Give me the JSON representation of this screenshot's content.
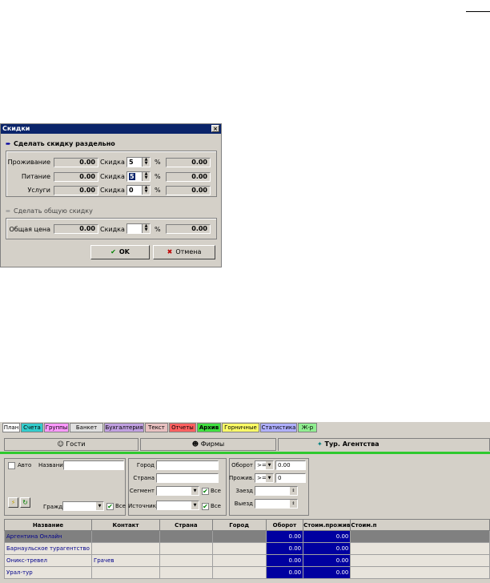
{
  "dialog": {
    "title": "Скидки",
    "close_glyph": "×",
    "section_separate": "Сделать скидку раздельно",
    "section_total": "Сделать общую скидку",
    "rows": [
      {
        "label": "Проживание",
        "base": "0.00",
        "discount_label": "Скидка",
        "discount": "5",
        "percent": "%",
        "result": "0.00"
      },
      {
        "label": "Питание",
        "base": "0.00",
        "discount_label": "Скидка",
        "discount": "5",
        "percent": "%",
        "result": "0.00"
      },
      {
        "label": "Услуги",
        "base": "0.00",
        "discount_label": "Скидка",
        "discount": "0",
        "percent": "%",
        "result": "0.00"
      }
    ],
    "total": {
      "label": "Общая цена",
      "base": "0.00",
      "discount_label": "Скидка",
      "discount": "",
      "percent": "%",
      "result": "0.00"
    },
    "ok_label": "OK",
    "cancel_label": "Отмена"
  },
  "window": {
    "tabs": [
      {
        "label": "План",
        "color": "#ffffff"
      },
      {
        "label": "Счета",
        "color": "#33cccc"
      },
      {
        "label": "Группы",
        "color": "#ff99ff"
      },
      {
        "label": "Банкет",
        "color": "#e0e0e0"
      },
      {
        "label": "Бухгалтерия",
        "color": "#c0a0e0"
      },
      {
        "label": "Текст",
        "color": "#e8c0c0"
      },
      {
        "label": "Отчеты",
        "color": "#ff6060"
      },
      {
        "label": "Архив",
        "color": "#40e040"
      },
      {
        "label": "Горничные",
        "color": "#ffff66"
      },
      {
        "label": "Статистика",
        "color": "#b0b0ff"
      },
      {
        "label": "Ж-р",
        "color": "#90ee90"
      }
    ],
    "subtabs": [
      {
        "label": "Гости",
        "icon": "person-icon"
      },
      {
        "label": "Фирмы",
        "icon": "people-icon"
      },
      {
        "label": "Тур. Агентства",
        "icon": "globe-icon"
      }
    ],
    "filters": {
      "auto_label": "Авто",
      "name_label": "Название",
      "name_value": "",
      "citizenship_label": "Гражд.",
      "all_label": "Все",
      "city_label": "Город",
      "country_label": "Страна",
      "segment_label": "Сегмент",
      "source_label": "Источник",
      "turnover_label": "Оборот",
      "turnover_op": ">=",
      "turnover_value": "0.00",
      "stay_label": "Прожив.",
      "stay_op": ">=",
      "stay_value": "0",
      "checkin_label": "Заезд",
      "checkout_label": "Выезд"
    },
    "table": {
      "columns": [
        "Название",
        "Контакт",
        "Страна",
        "Город",
        "Оборот",
        "Стоим.прожив",
        "Стоим.п"
      ],
      "rows": [
        {
          "name": "Аргентина Онлайн",
          "contact": "",
          "country": "",
          "city": "",
          "turnover": "0.00",
          "stay_cost": "0.00",
          "other": ""
        },
        {
          "name": "Барнаульское турагентство",
          "contact": "",
          "country": "",
          "city": "",
          "turnover": "0.00",
          "stay_cost": "0.00",
          "other": ""
        },
        {
          "name": "Оникс-тревел",
          "contact": "Грачев",
          "country": "",
          "city": "",
          "turnover": "0.00",
          "stay_cost": "0.00",
          "other": ""
        },
        {
          "name": "Урал-тур",
          "contact": "",
          "country": "",
          "city": "",
          "turnover": "0.00",
          "stay_cost": "0.00",
          "other": ""
        }
      ]
    }
  }
}
